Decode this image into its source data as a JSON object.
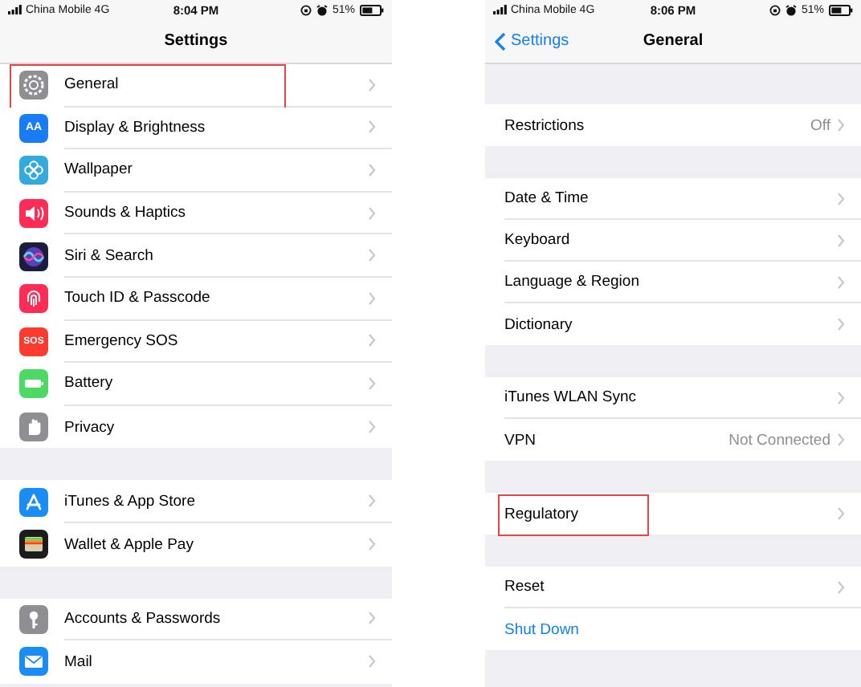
{
  "screens": [
    {
      "status_bar": {
        "carrier": "China Mobile 4G",
        "time": "8:04 PM",
        "battery": "51%"
      },
      "nav": {
        "title": "Settings"
      },
      "groups": [
        {
          "items": [
            {
              "label": "General",
              "highlighted": true
            },
            {
              "label": "Display & Brightness",
              "icon_text": "AA",
              "highlighted": false
            },
            {
              "label": "Wallpaper",
              "highlighted": false
            },
            {
              "label": "Sounds & Haptics",
              "highlighted": false
            },
            {
              "label": "Siri & Search",
              "highlighted": false
            },
            {
              "label": "Touch ID & Passcode",
              "highlighted": false
            },
            {
              "label": "Emergency SOS",
              "icon_text": "SOS",
              "highlighted": false
            },
            {
              "label": "Battery",
              "highlighted": false
            },
            {
              "label": "Privacy",
              "highlighted": false
            }
          ]
        },
        {
          "items": [
            {
              "label": "iTunes & App Store",
              "highlighted": false
            },
            {
              "label": "Wallet & Apple Pay",
              "highlighted": false
            }
          ]
        },
        {
          "items": [
            {
              "label": "Accounts & Passwords",
              "highlighted": false
            },
            {
              "label": "Mail",
              "highlighted": false
            }
          ]
        }
      ]
    },
    {
      "status_bar": {
        "carrier": "China Mobile 4G",
        "time": "8:06 PM",
        "battery": "51%"
      },
      "nav": {
        "title": "General",
        "back": "Settings"
      },
      "groups": [
        {
          "items": [
            {
              "label": "Restrictions",
              "value": "Off",
              "kind": "disclosure",
              "highlighted": false
            }
          ]
        },
        {
          "items": [
            {
              "label": "Date & Time",
              "kind": "disclosure",
              "highlighted": false
            },
            {
              "label": "Keyboard",
              "kind": "disclosure",
              "highlighted": false
            },
            {
              "label": "Language & Region",
              "kind": "disclosure",
              "highlighted": false
            },
            {
              "label": "Dictionary",
              "kind": "disclosure",
              "highlighted": false
            }
          ]
        },
        {
          "items": [
            {
              "label": "iTunes WLAN Sync",
              "kind": "disclosure",
              "highlighted": false
            },
            {
              "label": "VPN",
              "value": "Not Connected",
              "kind": "disclosure",
              "highlighted": false
            }
          ]
        },
        {
          "items": [
            {
              "label": "Regulatory",
              "kind": "disclosure",
              "highlighted": true
            }
          ]
        },
        {
          "items": [
            {
              "label": "Reset",
              "kind": "disclosure",
              "highlighted": false
            },
            {
              "label": "Shut Down",
              "kind": "action",
              "highlighted": false
            }
          ]
        }
      ]
    }
  ]
}
